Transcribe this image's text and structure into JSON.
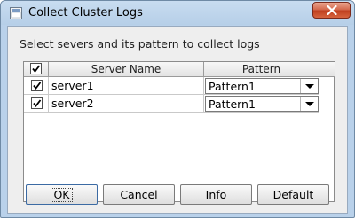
{
  "window": {
    "title": "Collect Cluster Logs"
  },
  "prompt": "Select severs and its pattern to collect logs",
  "table": {
    "headers": {
      "check": "",
      "server_name": "Server Name",
      "pattern": "Pattern"
    },
    "rows": [
      {
        "checked": true,
        "server": "server1",
        "pattern": "Pattern1"
      },
      {
        "checked": true,
        "server": "server2",
        "pattern": "Pattern1"
      }
    ]
  },
  "buttons": {
    "ok": "OK",
    "cancel": "Cancel",
    "info": "Info",
    "default": "Default"
  },
  "colors": {
    "titlebar": "#b9d1ea",
    "close_button": "#c74a2a"
  }
}
